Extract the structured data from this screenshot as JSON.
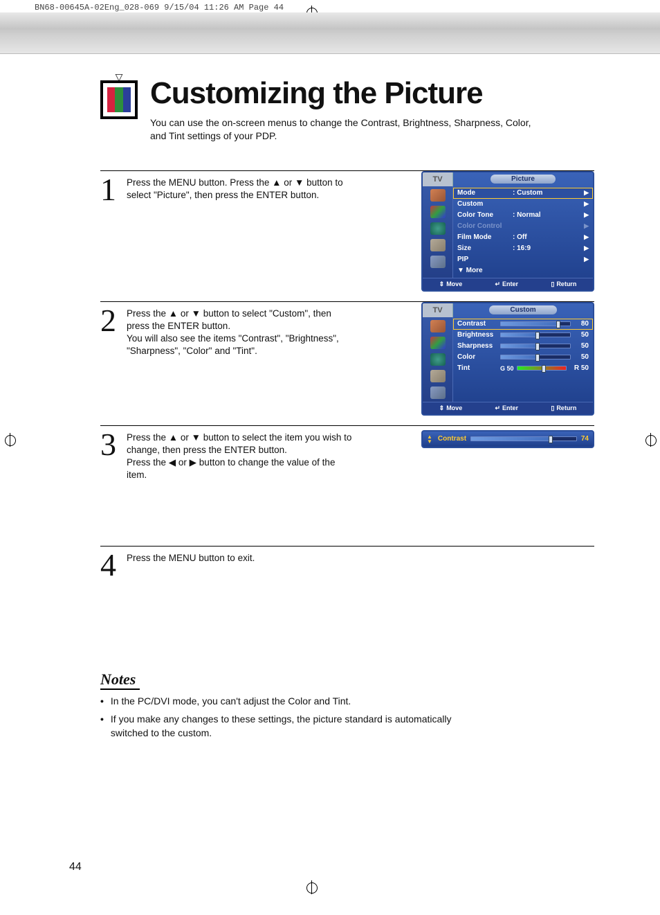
{
  "header_info": "BN68-00645A-02Eng_028-069  9/15/04  11:26 AM  Page 44",
  "title": "Customizing the Picture",
  "intro": "You can use the on-screen menus to change the Contrast, Brightness, Sharpness, Color, and Tint settings of your PDP.",
  "steps": [
    {
      "num": "1",
      "text": "Press the MENU button. Press the ▲ or ▼ button to select \"Picture\", then press the ENTER button."
    },
    {
      "num": "2",
      "text": "Press the ▲ or ▼ button to select \"Custom\", then press the ENTER button.\nYou will also see the items \"Contrast\", \"Brightness\", \"Sharpness\", \"Color\" and \"Tint\"."
    },
    {
      "num": "3",
      "text": "Press the ▲ or ▼ button to select the item you wish to change, then press the ENTER button.\nPress the ◀ or ▶ button to change the value of the item."
    },
    {
      "num": "4",
      "text": "Press the MENU button to exit."
    }
  ],
  "osd1": {
    "tv": "TV",
    "title": "Picture",
    "rows": [
      {
        "label": "Mode",
        "value": ":  Custom",
        "sel": true,
        "chev": true
      },
      {
        "label": "Custom",
        "value": "",
        "chev": true
      },
      {
        "label": "Color Tone",
        "value": ":  Normal",
        "chev": true
      },
      {
        "label": "Color Control",
        "value": "",
        "dim": true,
        "chev": true
      },
      {
        "label": "Film Mode",
        "value": ":  Off",
        "chev": true
      },
      {
        "label": "Size",
        "value": ":  16:9",
        "chev": true
      },
      {
        "label": "PIP",
        "value": "",
        "chev": true
      },
      {
        "label": "▼ More",
        "value": ""
      }
    ],
    "foot": {
      "move": "Move",
      "enter": "Enter",
      "return": "Return"
    }
  },
  "osd2": {
    "tv": "TV",
    "title": "Custom",
    "sliders": [
      {
        "label": "Contrast",
        "value": 80,
        "sel": true
      },
      {
        "label": "Brightness",
        "value": 50
      },
      {
        "label": "Sharpness",
        "value": 50
      },
      {
        "label": "Color",
        "value": 50
      }
    ],
    "tint": {
      "label": "Tint",
      "left": "G 50",
      "right": "R 50",
      "value": 50
    },
    "foot": {
      "move": "Move",
      "enter": "Enter",
      "return": "Return"
    }
  },
  "single_slider": {
    "label": "Contrast",
    "value": 74
  },
  "notes_title": "Notes",
  "notes": [
    "In the PC/DVI mode, you can't adjust the Color and Tint.",
    "If you make any changes to these settings, the picture standard is automatically switched to the custom."
  ],
  "page_number": "44"
}
